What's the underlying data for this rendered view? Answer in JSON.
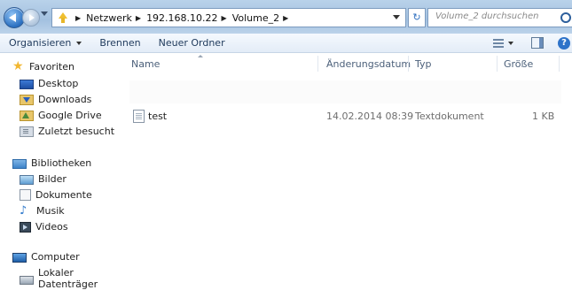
{
  "address": {
    "crumbs": [
      "Netzwerk",
      "192.168.10.22",
      "Volume_2"
    ],
    "search_placeholder": "Volume_2 durchsuchen"
  },
  "toolbar": {
    "organize": "Organisieren",
    "burn": "Brennen",
    "new_folder": "Neuer Ordner"
  },
  "sidebar": {
    "favorites": {
      "label": "Favoriten",
      "items": [
        "Desktop",
        "Downloads",
        "Google Drive",
        "Zuletzt besucht"
      ]
    },
    "libraries": {
      "label": "Bibliotheken",
      "items": [
        "Bilder",
        "Dokumente",
        "Musik",
        "Videos"
      ]
    },
    "computer": {
      "label": "Computer",
      "items": [
        "Lokaler Datenträger"
      ]
    }
  },
  "columns": [
    "Name",
    "Änderungsdatum",
    "Typ",
    "Größe"
  ],
  "files": [
    {
      "name": "test",
      "modified": "14.02.2014 08:39",
      "type": "Textdokument",
      "size": "1 KB"
    }
  ]
}
